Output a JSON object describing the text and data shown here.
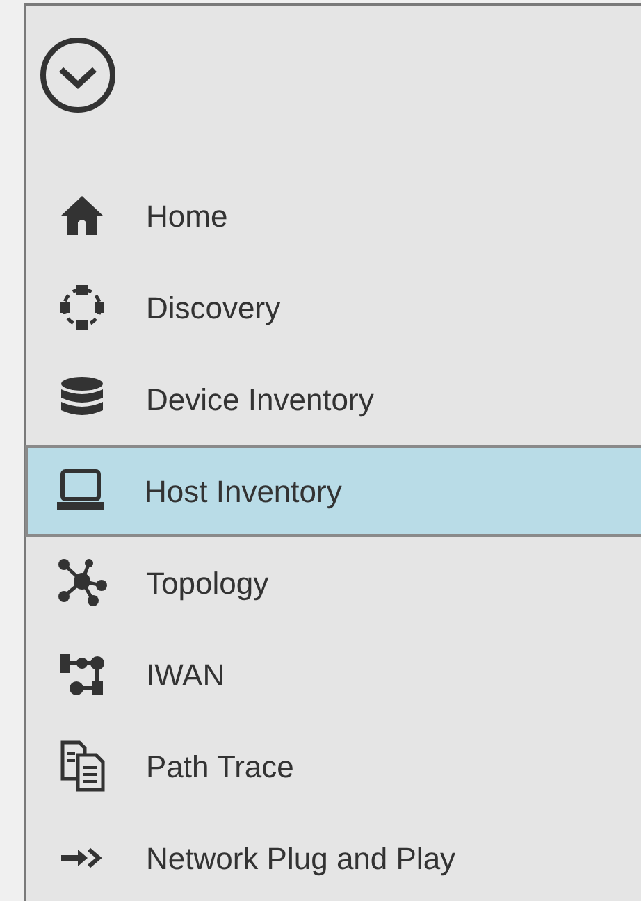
{
  "nav": {
    "items": [
      {
        "label": "Home",
        "selected": false
      },
      {
        "label": "Discovery",
        "selected": false
      },
      {
        "label": "Device Inventory",
        "selected": false
      },
      {
        "label": "Host Inventory",
        "selected": true
      },
      {
        "label": "Topology",
        "selected": false
      },
      {
        "label": "IWAN",
        "selected": false
      },
      {
        "label": "Path Trace",
        "selected": false
      },
      {
        "label": "Network Plug and Play",
        "selected": false
      }
    ]
  }
}
